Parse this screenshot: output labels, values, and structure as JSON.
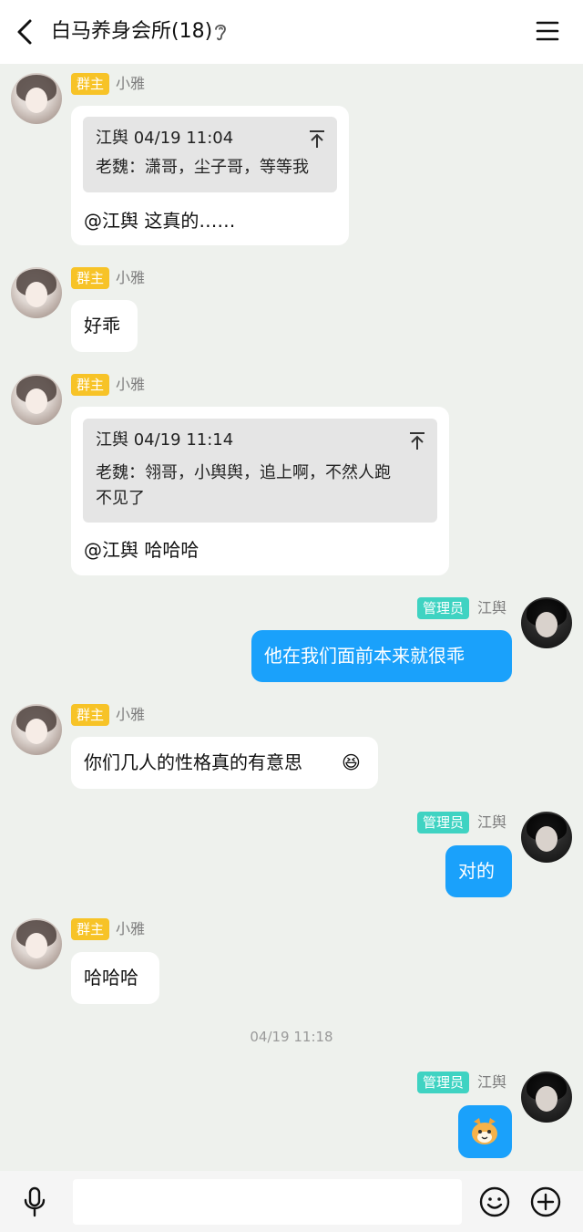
{
  "header": {
    "title": "白马养身会所(18)"
  },
  "members": {
    "xiaoya": {
      "name": "小雅",
      "role": "群主",
      "role_color": "#f7c327"
    },
    "jiangyu": {
      "name": "江舆",
      "role": "管理员",
      "role_color": "#3fd3c2"
    }
  },
  "messages": [
    {
      "sender": "小雅",
      "role": "群主",
      "quote_header": "江舆 04/19 11:04",
      "quote_text": "老魏：潇哥，尘子哥，等等我",
      "text": "@江舆 这真的……"
    },
    {
      "sender": "小雅",
      "role": "群主",
      "text": "好乖"
    },
    {
      "sender": "小雅",
      "role": "群主",
      "quote_header": "江舆 04/19 11:14",
      "quote_text_line1": "老魏：翎哥，小舆舆，追上啊，不然人跑",
      "quote_text_line2": "不见了",
      "text": "@江舆 哈哈哈"
    },
    {
      "sender": "江舆",
      "role": "管理员",
      "text": "他在我们面前本来就很乖"
    },
    {
      "sender": "小雅",
      "role": "群主",
      "text": "你们几人的性格真的有意思",
      "emoji": "😆"
    },
    {
      "sender": "江舆",
      "role": "管理员",
      "text": "对的"
    },
    {
      "sender": "小雅",
      "role": "群主",
      "text": "哈哈哈"
    },
    {
      "sender": "江舆",
      "role": "管理员",
      "sticker": "cat-face-sticker"
    }
  ],
  "timestamp": "04/19 11:18",
  "input": {
    "value": "",
    "placeholder": ""
  },
  "colors": {
    "background": "#eef1ed",
    "outgoing_bubble": "#1aa1fb",
    "incoming_bubble": "#ffffff"
  }
}
